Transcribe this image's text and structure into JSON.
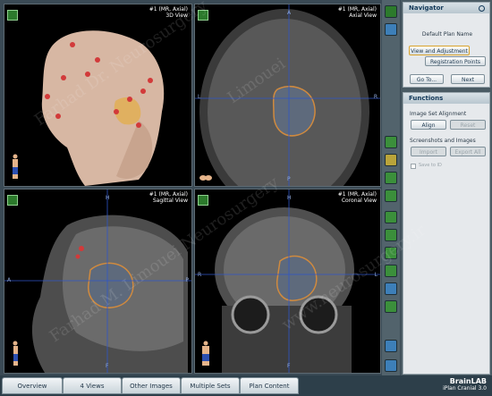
{
  "viewports": [
    {
      "title_line1": "#1 (MR, Axial)",
      "title_line2": "3D View"
    },
    {
      "title_line1": "#1 (MR, Axial)",
      "title_line2": "Axial View",
      "top": "A",
      "bottom": "P",
      "left": "L",
      "right": "R"
    },
    {
      "title_line1": "#1 (MR, Axial)",
      "title_line2": "Sagittal View",
      "top": "H",
      "bottom": "F",
      "left": "A",
      "right": "P"
    },
    {
      "title_line1": "#1 (MR, Axial)",
      "title_line2": "Coronal View",
      "top": "H",
      "bottom": "F",
      "left": "R",
      "right": "L"
    }
  ],
  "navigator": {
    "title": "Navigator",
    "plan_name": "Default Plan Name",
    "view_adjust": "View and Adjustment",
    "registration": "Registration Points",
    "go_to": "Go To...",
    "next": "Next"
  },
  "functions": {
    "title": "Functions",
    "alignment_title": "Image Set Alignment",
    "align": "Align",
    "reset": "Reset",
    "screenshots_title": "Screenshots and Images",
    "import": "Import",
    "export": "Export All",
    "checkbox_label": "Save to ID"
  },
  "tabs": [
    "Overview",
    "4 Views",
    "Other Images",
    "Multiple Sets",
    "Plan Content"
  ],
  "brand": {
    "name": "BrainLAB",
    "product": "iPlan Cranial 3.0"
  },
  "watermarks": [
    "Farhad Dr. Neurosurgery",
    "Limouei",
    "Farhad M. Limouei Neurosurgery",
    "www.neurosurgery.ir"
  ],
  "colors": {
    "contour": "#d08a3e",
    "crosshair": "#2f56c8",
    "accent": "#d9a32c"
  }
}
